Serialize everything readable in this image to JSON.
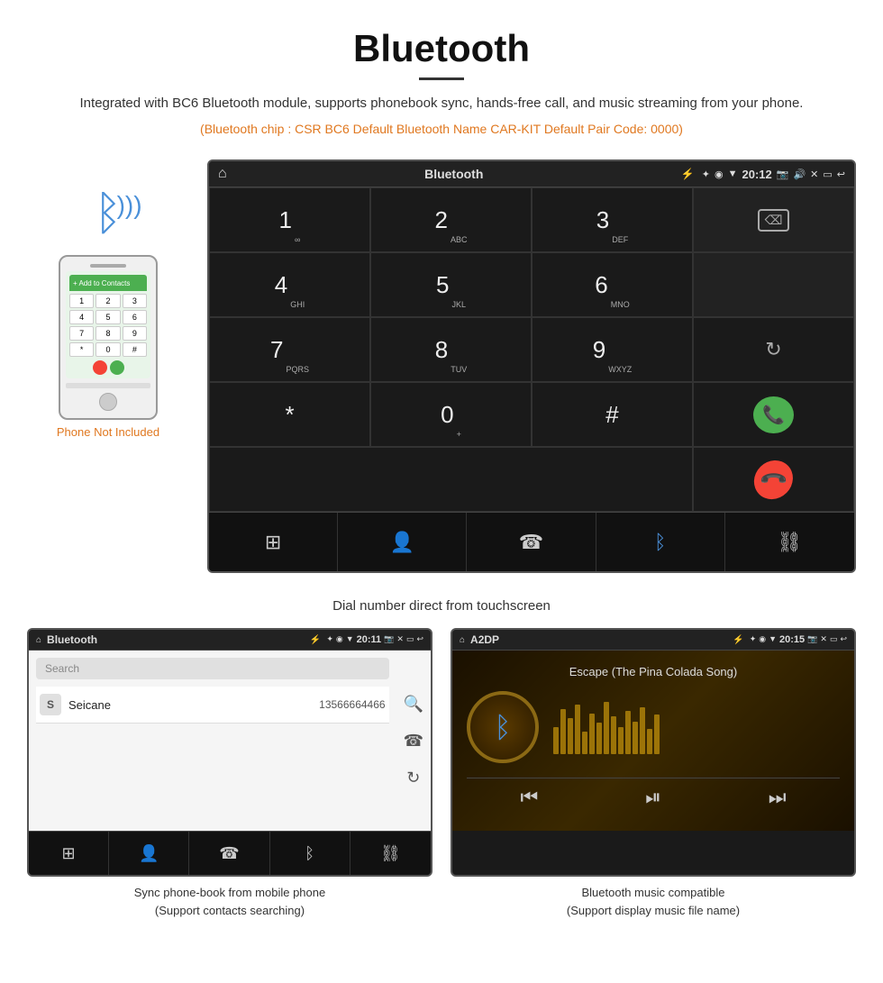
{
  "page": {
    "title": "Bluetooth",
    "subtitle": "Integrated with BC6 Bluetooth module, supports phonebook sync, hands-free call, and music streaming from your phone.",
    "specs": "(Bluetooth chip : CSR BC6    Default Bluetooth Name CAR-KIT    Default Pair Code: 0000)",
    "dial_caption": "Dial number direct from touchscreen",
    "phone_label": "Phone Not Included"
  },
  "car_screen": {
    "screen_title": "Bluetooth",
    "time": "20:12",
    "status_bar_icons": "* ◉ ▼",
    "keys": [
      {
        "main": "1",
        "sub": "∞"
      },
      {
        "main": "2",
        "sub": "ABC"
      },
      {
        "main": "3",
        "sub": "DEF"
      },
      {
        "main": "",
        "sub": ""
      },
      {
        "main": "4",
        "sub": "GHI"
      },
      {
        "main": "5",
        "sub": "JKL"
      },
      {
        "main": "6",
        "sub": "MNO"
      },
      {
        "main": "",
        "sub": ""
      },
      {
        "main": "7",
        "sub": "PQRS"
      },
      {
        "main": "8",
        "sub": "TUV"
      },
      {
        "main": "9",
        "sub": "WXYZ"
      },
      {
        "main": "sync",
        "sub": ""
      },
      {
        "main": "*",
        "sub": ""
      },
      {
        "main": "0",
        "sub": "+"
      },
      {
        "main": "#",
        "sub": ""
      },
      {
        "main": "call",
        "sub": ""
      },
      {
        "main": "endcall",
        "sub": ""
      }
    ],
    "bottom_icons": [
      "grid",
      "person",
      "phone",
      "bluetooth",
      "link"
    ]
  },
  "phonebook_screen": {
    "screen_title": "Bluetooth",
    "time": "20:11",
    "search_placeholder": "Search",
    "contact": {
      "letter": "S",
      "name": "Seicane",
      "number": "13566664466"
    },
    "caption_line1": "Sync phone-book from mobile phone",
    "caption_line2": "(Support contacts searching)"
  },
  "music_screen": {
    "screen_title": "A2DP",
    "time": "20:15",
    "song_title": "Escape (The Pina Colada Song)",
    "caption_line1": "Bluetooth music compatible",
    "caption_line2": "(Support display music file name)"
  },
  "colors": {
    "orange": "#e07820",
    "blue": "#4a90d9",
    "green": "#4caf50",
    "red": "#f44336",
    "dark_bg": "#1a1a1a",
    "status_bar": "#222"
  }
}
